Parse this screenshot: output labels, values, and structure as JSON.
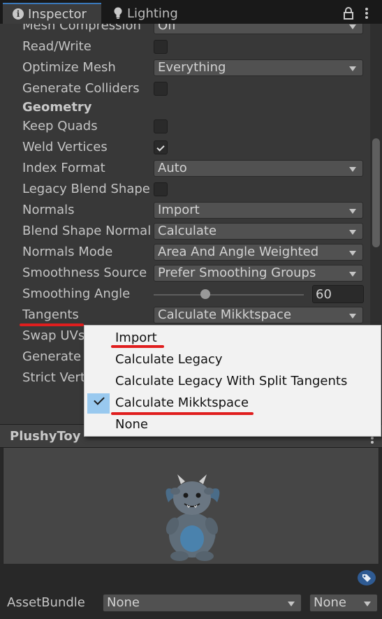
{
  "tabs": {
    "inspector": "Inspector",
    "lighting": "Lighting"
  },
  "rows": [
    {
      "label": "Mesh Compression",
      "type": "dropdown",
      "value": "Off"
    },
    {
      "label": "Read/Write",
      "type": "checkbox",
      "checked": false
    },
    {
      "label": "Optimize Mesh",
      "type": "dropdown",
      "value": "Everything"
    },
    {
      "label": "Generate Colliders",
      "type": "checkbox",
      "checked": false
    },
    {
      "label": "Geometry",
      "type": "header"
    },
    {
      "label": "Keep Quads",
      "type": "checkbox",
      "checked": false
    },
    {
      "label": "Weld Vertices",
      "type": "checkbox",
      "checked": true
    },
    {
      "label": "Index Format",
      "type": "dropdown",
      "value": "Auto"
    },
    {
      "label": "Legacy Blend Shape",
      "type": "checkbox",
      "checked": false
    },
    {
      "label": "Normals",
      "type": "dropdown",
      "value": "Import"
    },
    {
      "label": "Blend Shape Normals",
      "type": "dropdown",
      "value": "Calculate"
    },
    {
      "label": "Normals Mode",
      "type": "dropdown",
      "value": "Area And Angle Weighted"
    },
    {
      "label": "Smoothness Source",
      "type": "dropdown",
      "value": "Prefer Smoothing Groups"
    },
    {
      "label": "Smoothing Angle",
      "type": "slider",
      "value": "60"
    },
    {
      "label": "Tangents",
      "type": "dropdown",
      "value": "Calculate Mikktspace"
    },
    {
      "label": "Swap UVs",
      "type": "checkbox",
      "checked": false
    },
    {
      "label": "Generate Lightmap UVs",
      "type": "checkbox",
      "checked": false
    },
    {
      "label": "Strict Vertex Data Checks",
      "type": "checkbox",
      "checked": false
    }
  ],
  "popup": {
    "items": [
      "Import",
      "Calculate Legacy",
      "Calculate Legacy With Split Tangents",
      "Calculate Mikktspace",
      "None"
    ],
    "selected_index": 3
  },
  "preview": {
    "title": "PlushyToy"
  },
  "assetbundle": {
    "label": "AssetBundle",
    "name_value": "None",
    "variant_value": "None"
  },
  "colors": {
    "accent": "#3a79bb",
    "annotation": "#e01e1e",
    "menu_check": "#99c9ef"
  }
}
